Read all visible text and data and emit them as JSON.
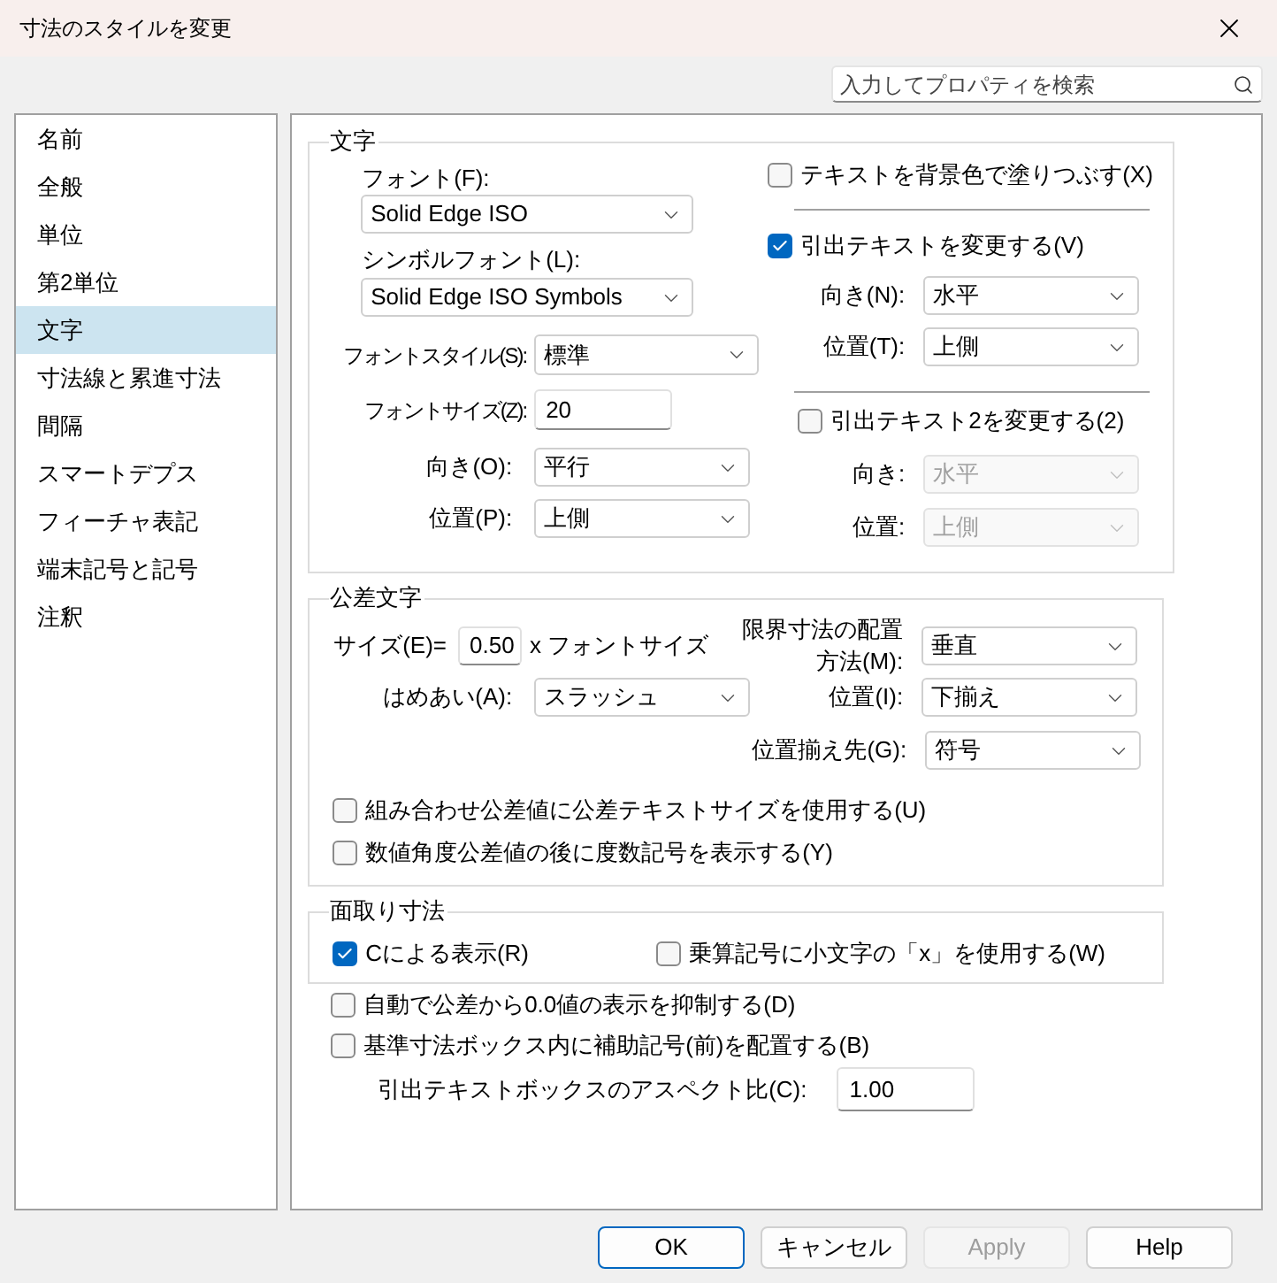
{
  "window": {
    "title": "寸法のスタイルを変更"
  },
  "search": {
    "placeholder": "入力してプロパティを検索"
  },
  "sidebar": {
    "items": [
      {
        "label": "名前",
        "selected": false
      },
      {
        "label": "全般",
        "selected": false
      },
      {
        "label": "単位",
        "selected": false
      },
      {
        "label": "第2単位",
        "selected": false
      },
      {
        "label": "文字",
        "selected": true
      },
      {
        "label": "寸法線と累進寸法",
        "selected": false
      },
      {
        "label": "間隔",
        "selected": false
      },
      {
        "label": "スマートデプス",
        "selected": false
      },
      {
        "label": "フィーチャ表記",
        "selected": false
      },
      {
        "label": "端末記号と記号",
        "selected": false
      },
      {
        "label": "注釈",
        "selected": false
      }
    ]
  },
  "text_group": {
    "title": "文字",
    "font": {
      "label": "フォント(F):",
      "value": "Solid Edge ISO"
    },
    "symbol_font": {
      "label": "シンボルフォント(L):",
      "value": "Solid Edge ISO Symbols"
    },
    "font_style": {
      "label": "フォントスタイル(S):",
      "value": "標準"
    },
    "font_size": {
      "label": "フォントサイズ(Z):",
      "value": "20"
    },
    "orientation": {
      "label": "向き(O):",
      "value": "平行"
    },
    "position": {
      "label": "位置(P):",
      "value": "上側"
    },
    "fill_background": {
      "label": "テキストを背景色で塗りつぶす(X)",
      "checked": false
    },
    "change_leader_text": {
      "label": "引出テキストを変更する(V)",
      "checked": true
    },
    "leader_orientation": {
      "label": "向き(N):",
      "value": "水平",
      "disabled": false
    },
    "leader_position": {
      "label": "位置(T):",
      "value": "上側",
      "disabled": false
    },
    "change_leader_text_2": {
      "label": "引出テキスト2を変更する(2)",
      "checked": false
    },
    "leader2_orientation": {
      "label": "向き:",
      "value": "水平",
      "disabled": true
    },
    "leader2_position": {
      "label": "位置:",
      "value": "上側",
      "disabled": true
    }
  },
  "tolerance_group": {
    "title": "公差文字",
    "size": {
      "label": "サイズ(E)=",
      "value": "0.50",
      "suffix": "x フォントサイズ"
    },
    "limit_placement": {
      "label": "限界寸法の配置方法(M):",
      "value": "垂直"
    },
    "fit": {
      "label": "はめあい(A):",
      "value": "スラッシュ"
    },
    "position": {
      "label": "位置(I):",
      "value": "下揃え"
    },
    "align_to": {
      "label": "位置揃え先(G):",
      "value": "符号"
    },
    "options": [
      {
        "label": "組み合わせ公差値に公差テキストサイズを使用する(U)",
        "checked": false
      },
      {
        "label": "数値角度公差値の後に度数記号を表示する(Y)",
        "checked": false
      }
    ]
  },
  "chamfer_group": {
    "title": "面取り寸法",
    "options": [
      {
        "label": "Cによる表示(R)",
        "checked": true
      },
      {
        "label": "乗算記号に小文字の「x」を使用する(W)",
        "checked": false
      }
    ]
  },
  "options": [
    {
      "label": "自動で公差から0.0値の表示を抑制する(D)",
      "checked": false
    },
    {
      "label": "基準寸法ボックス内に補助記号(前)を配置する(B)",
      "checked": false
    }
  ],
  "aspect_ratio": {
    "label": "引出テキストボックスのアスペクト比(C):",
    "value": "1.00"
  },
  "buttons": [
    {
      "label": "OK",
      "default": true,
      "disabled": false
    },
    {
      "label": "キャンセル",
      "default": false,
      "disabled": false
    },
    {
      "label": "Apply",
      "default": false,
      "disabled": true
    },
    {
      "label": "Help",
      "default": false,
      "disabled": false
    }
  ]
}
